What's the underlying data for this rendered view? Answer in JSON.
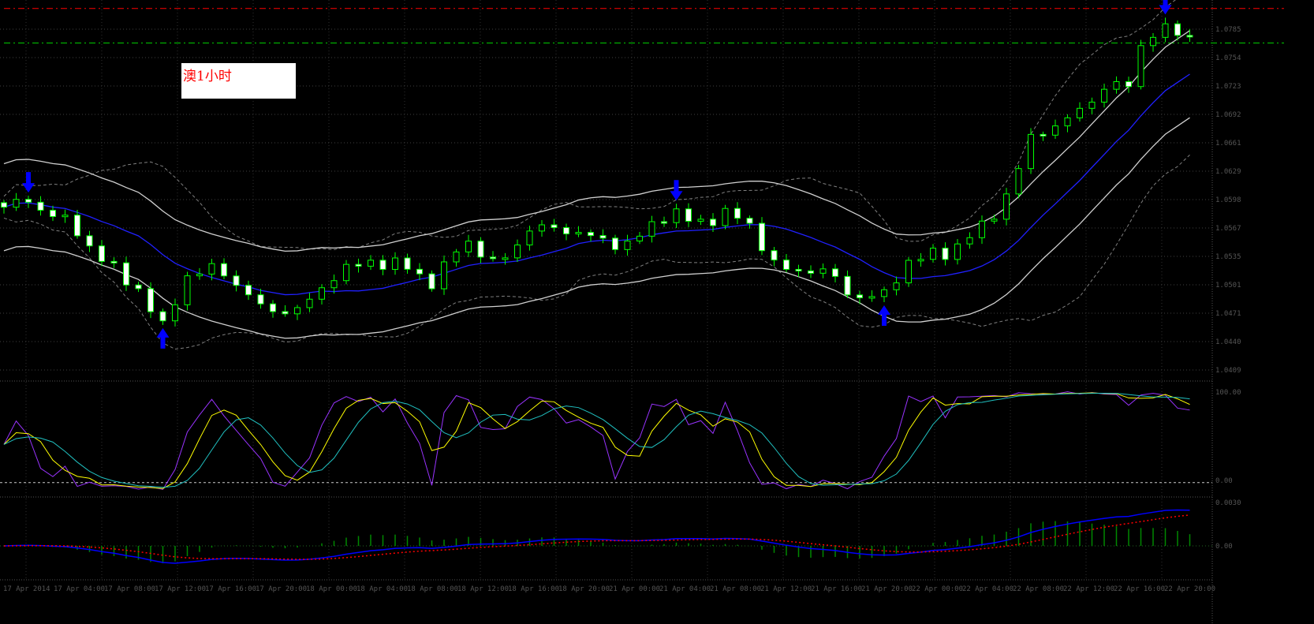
{
  "chart_title_label": "澳1小时",
  "colors": {
    "bull_outline": "#00ff00",
    "bear_body": "#ffffff",
    "bull_body": "#000000",
    "ma": "#2020ff",
    "envelope": "#d0d0d0",
    "bollinger": "#808080",
    "stoch_k": "#9933ff",
    "stoch_d": "#ffff00",
    "stoch_slow": "#20c0c0",
    "macd": "#0000ff",
    "signal": "#ff0000",
    "histogram": "#008800",
    "resistance": "#ff0000",
    "current": "#00cc00",
    "grid": "#404040"
  },
  "chart_data": {
    "type": "candlestick",
    "ylim": [
      1.04,
      1.08
    ],
    "bars": 98,
    "close_keypoints": [
      [
        0,
        1.0589
      ],
      [
        2,
        1.0596
      ],
      [
        5.5,
        1.0569
      ],
      [
        8.7,
        1.0522
      ],
      [
        11.3,
        1.0496
      ],
      [
        12.9,
        1.0452
      ],
      [
        14.8,
        1.0513
      ],
      [
        17.7,
        1.0522
      ],
      [
        21,
        1.0478
      ],
      [
        24.2,
        1.0474
      ],
      [
        26.8,
        1.0513
      ],
      [
        30,
        1.053
      ],
      [
        33.2,
        1.0522
      ],
      [
        35.2,
        1.0504
      ],
      [
        37.7,
        1.0556
      ],
      [
        40.3,
        1.0522
      ],
      [
        42.9,
        1.0565
      ],
      [
        46.1,
        1.0565
      ],
      [
        48.7,
        1.0552
      ],
      [
        51.3,
        1.0548
      ],
      [
        54.5,
        1.0587
      ],
      [
        56.5,
        1.0569
      ],
      [
        59,
        1.0583
      ],
      [
        61,
        1.0569
      ],
      [
        63.5,
        1.0517
      ],
      [
        66.8,
        1.0522
      ],
      [
        69.4,
        1.0491
      ],
      [
        72,
        1.0491
      ],
      [
        73.9,
        1.053
      ],
      [
        77.1,
        1.0539
      ],
      [
        80.3,
        1.0569
      ],
      [
        82.3,
        1.0609
      ],
      [
        84.2,
        1.067
      ],
      [
        87.4,
        1.0687
      ],
      [
        90,
        1.0722
      ],
      [
        92,
        1.0722
      ],
      [
        93.2,
        1.0778
      ],
      [
        94.8,
        1.0784
      ],
      [
        97,
        1.0778
      ]
    ],
    "sell_arrows_at_bar": [
      2,
      55,
      95
    ],
    "buy_arrows_at_bar": [
      13,
      72
    ],
    "resistance_level": 1.0808,
    "current_price": 1.077,
    "price_axis_labels": [
      "1.0785",
      "1.0754",
      "1.0723",
      "1.0692",
      "1.0661",
      "1.0629",
      "1.0598",
      "1.0567",
      "1.0535",
      "1.0501",
      "1.0471",
      "1.0440",
      "1.0409"
    ],
    "oscillator": {
      "ylim": [
        0,
        100
      ],
      "level": 10,
      "level_label": "0.00",
      "top_label": "100.00"
    },
    "macd": {
      "top_label": "0.0030",
      "zero_label": "0.00"
    },
    "time_axis_labels": [
      "17 Apr 2014",
      "17 Apr 04:00",
      "17 Apr 08:00",
      "17 Apr 12:00",
      "17 Apr 16:00",
      "17 Apr 20:00",
      "18 Apr 00:00",
      "18 Apr 04:00",
      "18 Apr 08:00",
      "18 Apr 12:00",
      "18 Apr 16:00",
      "18 Apr 20:00",
      "21 Apr 00:00",
      "21 Apr 04:00",
      "21 Apr 08:00",
      "21 Apr 12:00",
      "21 Apr 16:00",
      "21 Apr 20:00",
      "22 Apr 00:00",
      "22 Apr 04:00",
      "22 Apr 08:00",
      "22 Apr 12:00",
      "22 Apr 16:00",
      "22 Apr 20:00"
    ]
  }
}
